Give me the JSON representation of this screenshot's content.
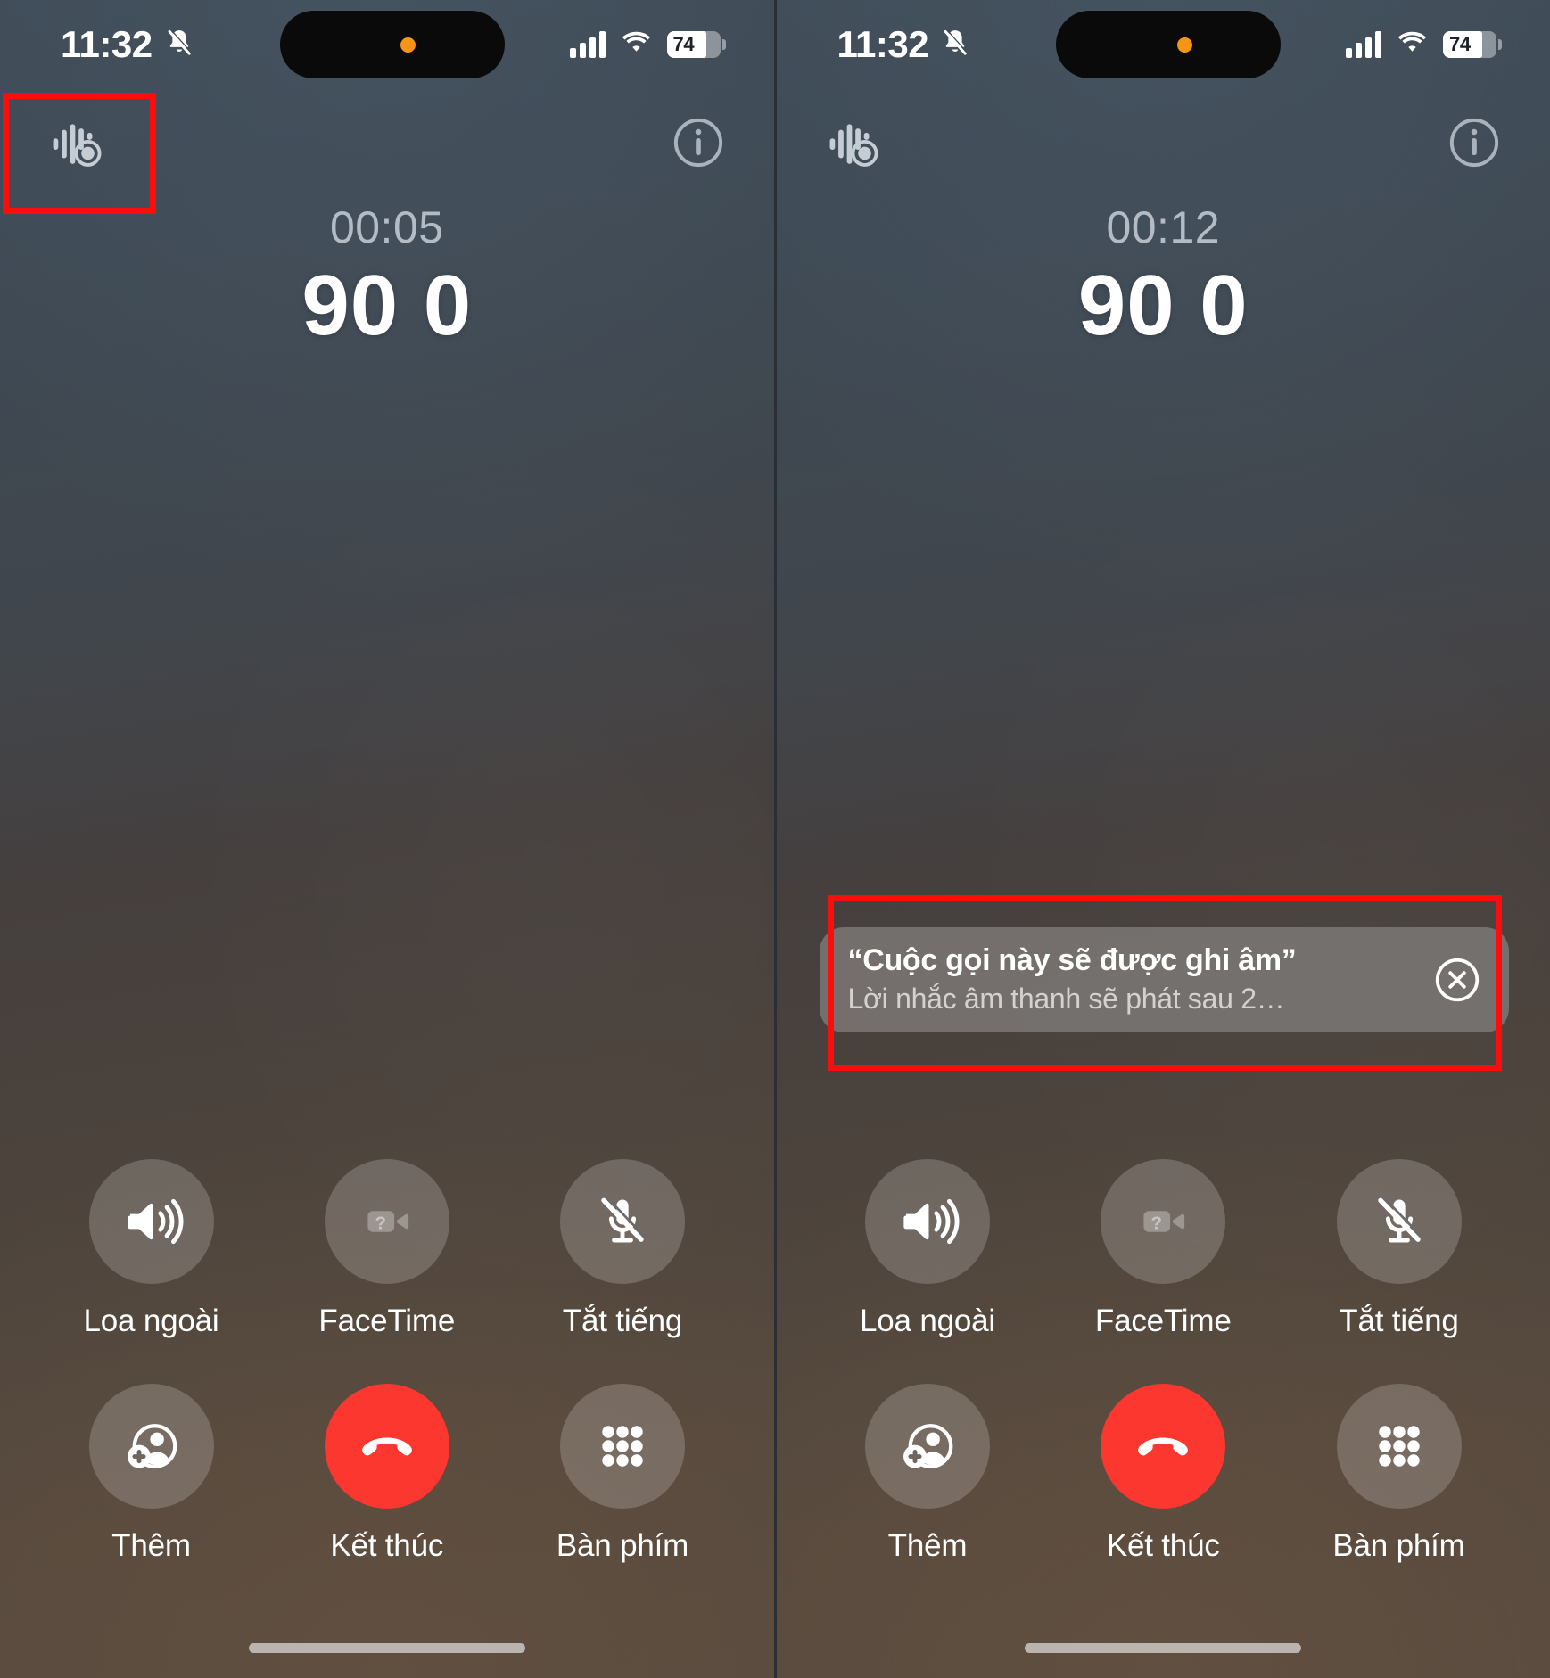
{
  "meta": {
    "app": "iPhone Phone app — active call screen (Vietnamese)",
    "accent_red": "#fb372f",
    "annotation_red": "#fc0d0d",
    "island_dot_orange": "#f59415"
  },
  "status_bar": {
    "time": "11:32",
    "silent_icon": "bell-slash-icon",
    "signal_icon": "cellular-signal-icon",
    "wifi_icon": "wifi-icon",
    "battery_percent": "74",
    "battery_level": 74
  },
  "panels": [
    {
      "id": "left",
      "record_indicator_icon": "call-recording-waveform-icon",
      "info_icon": "info-circle-icon",
      "call": {
        "timer": "00:05",
        "number": "90 0"
      },
      "toast": null,
      "controls": [
        [
          {
            "icon": "speaker-waves-icon",
            "label": "Loa ngoài",
            "state": "off"
          },
          {
            "icon": "facetime-video-unavailable-icon",
            "label": "FaceTime",
            "state": "disabled"
          },
          {
            "icon": "microphone-slash-icon",
            "label": "Tắt tiếng",
            "state": "off"
          }
        ],
        [
          {
            "icon": "add-contact-icon",
            "label": "Thêm",
            "state": "off"
          },
          {
            "icon": "end-call-handset-icon",
            "label": "Kết thúc",
            "state": "end"
          },
          {
            "icon": "keypad-grid-icon",
            "label": "Bàn phím",
            "state": "off"
          }
        ]
      ]
    },
    {
      "id": "right",
      "record_indicator_icon": "call-recording-waveform-icon",
      "info_icon": "info-circle-icon",
      "call": {
        "timer": "00:12",
        "number": "90 0"
      },
      "toast": {
        "title": "“Cuộc gọi này sẽ được ghi âm”",
        "subtitle": "Lời nhắc âm thanh sẽ phát sau 2…",
        "close_icon": "close-circle-icon"
      },
      "controls": [
        [
          {
            "icon": "speaker-waves-icon",
            "label": "Loa ngoài",
            "state": "off"
          },
          {
            "icon": "facetime-video-unavailable-icon",
            "label": "FaceTime",
            "state": "disabled"
          },
          {
            "icon": "microphone-slash-icon",
            "label": "Tắt tiếng",
            "state": "off"
          }
        ],
        [
          {
            "icon": "add-contact-icon",
            "label": "Thêm",
            "state": "off"
          },
          {
            "icon": "end-call-handset-icon",
            "label": "Kết thúc",
            "state": "end"
          },
          {
            "icon": "keypad-grid-icon",
            "label": "Bàn phím",
            "state": "off"
          }
        ]
      ]
    }
  ],
  "annotations": [
    {
      "target": "record-indicator-left",
      "shape": "rectangle",
      "color": "#fc0d0d"
    },
    {
      "target": "recording-toast-right",
      "shape": "rectangle",
      "color": "#fc0d0d"
    }
  ]
}
